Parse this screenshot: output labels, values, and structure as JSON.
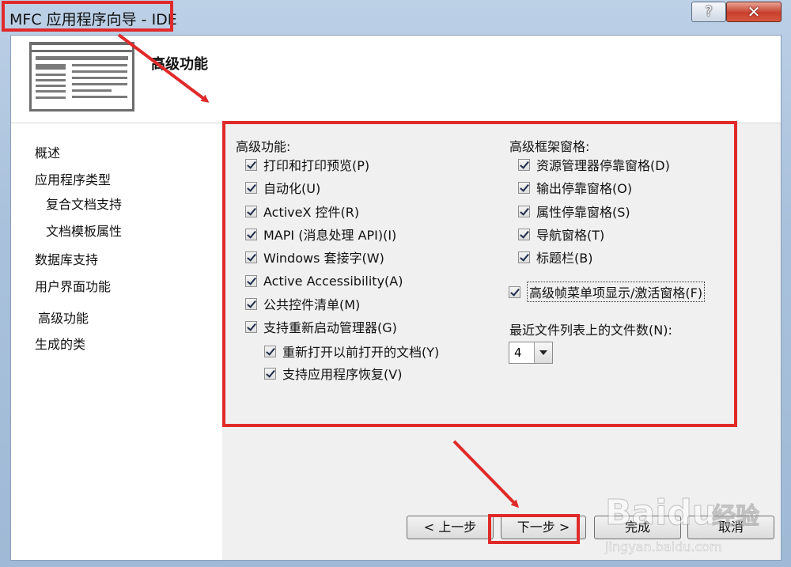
{
  "window": {
    "title": "MFC 应用程序向导 - IDE",
    "help_label": "?",
    "close_label": "✕"
  },
  "header": {
    "title": "高级功能",
    "icon": "wizard-page-icon"
  },
  "sidebar": {
    "items": [
      {
        "label": "概述"
      },
      {
        "label": "应用程序类型"
      },
      {
        "label": "复合文档支持"
      },
      {
        "label": "文档模板属性"
      },
      {
        "label": "数据库支持"
      },
      {
        "label": "用户界面功能"
      },
      {
        "label": "高级功能"
      },
      {
        "label": "生成的类"
      }
    ]
  },
  "advanced": {
    "label": "高级功能:",
    "options": [
      {
        "label": "打印和打印预览(P)",
        "checked": true
      },
      {
        "label": "自动化(U)",
        "checked": true
      },
      {
        "label": "ActiveX 控件(R)",
        "checked": true
      },
      {
        "label": "MAPI (消息处理 API)(I)",
        "checked": true
      },
      {
        "label": "Windows 套接字(W)",
        "checked": true
      },
      {
        "label": "Active Accessibility(A)",
        "checked": true
      },
      {
        "label": "公共控件清单(M)",
        "checked": true
      },
      {
        "label": "支持重新启动管理器(G)",
        "checked": true
      },
      {
        "label": "重新打开以前打开的文档(Y)",
        "checked": true
      },
      {
        "label": "支持应用程序恢复(V)",
        "checked": true
      }
    ]
  },
  "frame_panes": {
    "label": "高级框架窗格:",
    "options": [
      {
        "label": "资源管理器停靠窗格(D)",
        "checked": true
      },
      {
        "label": "输出停靠窗格(O)",
        "checked": true
      },
      {
        "label": "属性停靠窗格(S)",
        "checked": true
      },
      {
        "label": "导航窗格(T)",
        "checked": true
      },
      {
        "label": "标题栏(B)",
        "checked": true
      }
    ],
    "menu_option": {
      "label": "高级帧菜单项显示/激活窗格(F)",
      "checked": true
    }
  },
  "mru": {
    "label": "最近文件列表上的文件数(N):",
    "value": "4"
  },
  "buttons": {
    "prev": "< 上一步",
    "next": "下一步 >",
    "finish": "完成",
    "cancel": "取消"
  },
  "watermark": {
    "brand": "Baidu",
    "brand_cn": "经验",
    "url": "jingyan.baidu.com"
  },
  "colors": {
    "highlight": "#e02a2a"
  }
}
